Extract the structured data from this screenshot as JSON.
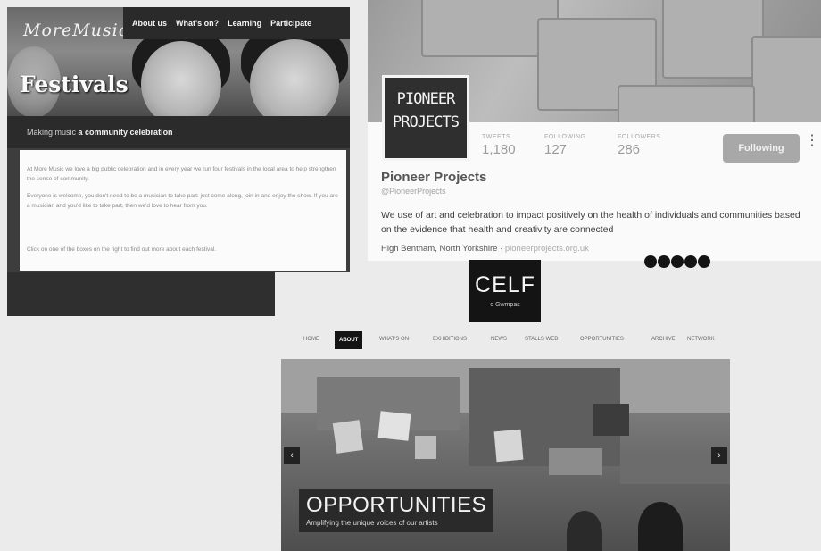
{
  "more_music": {
    "logo": "MoreMusic",
    "nav": [
      "About us",
      "What's on?",
      "Learning",
      "Participate"
    ],
    "hero_title": "Festivals",
    "tagline_prefix": "Making music",
    "tagline_bold": "a community celebration",
    "paragraphs": [
      "At More Music we love a big public celebration and in every year we run four festivals in the local area to help strengthen the sense of community.",
      "Everyone is welcome, you don't need to be a musician to take part: just come along, join in and enjoy the show. If you are a musician and you'd like to take part, then we'd love to hear from you.",
      "Click on one of the boxes on the right to find out more about each festival."
    ]
  },
  "pioneer": {
    "avatar_lines": [
      "PIONEER",
      "PROJECTS"
    ],
    "stats": [
      {
        "label": "TWEETS",
        "value": "1,180"
      },
      {
        "label": "FOLLOWING",
        "value": "127"
      },
      {
        "label": "FOLLOWERS",
        "value": "286"
      }
    ],
    "follow_button": "Following",
    "more_icon": "⋮",
    "name": "Pioneer Projects",
    "handle": "@PioneerProjects",
    "bio": "We use of art and celebration to impact positively on the health of individuals and communities based on the evidence that health and creativity are connected",
    "location": "High Bentham, North Yorkshire · ",
    "website": "pioneerprojects.org.uk"
  },
  "celf": {
    "logo_big": "CELF",
    "logo_small": "o Gwmpas",
    "nav": [
      "HOME",
      "ABOUT",
      "WHAT'S ON",
      "EXHIBITIONS",
      "NEWS",
      "STALLS WEB",
      "OPPORTUNITIES",
      "ARCHIVE",
      "NETWORK"
    ],
    "active_nav": "ABOUT",
    "slide_title": "OPPORTUNITIES",
    "slide_subtitle": "Amplifying the unique voices of our artists",
    "arrow_left": "‹",
    "arrow_right": "›"
  },
  "icons": [
    "social-icon-1",
    "social-icon-2",
    "social-icon-3",
    "social-icon-4",
    "social-icon-5",
    "more-options-icon",
    "arrow-left-icon",
    "arrow-right-icon"
  ]
}
